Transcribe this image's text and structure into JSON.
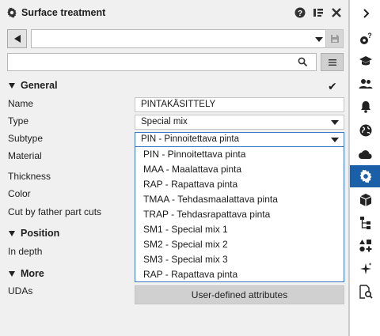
{
  "panel": {
    "title": "Surface treatment",
    "title_icon": "gear-icon",
    "header_icons": [
      "help-icon",
      "layout-icon",
      "close-icon"
    ]
  },
  "toolbar": {
    "preset_value": "",
    "search_placeholder": "",
    "search_value": ""
  },
  "sections": {
    "general": "General",
    "position": "Position",
    "more": "More"
  },
  "labels": {
    "name": "Name",
    "type": "Type",
    "subtype": "Subtype",
    "material": "Material",
    "thickness": "Thickness",
    "color": "Color",
    "cut_by_father": "Cut by father part cuts",
    "in_depth": "In depth",
    "udas": "UDAs"
  },
  "values": {
    "name": "PINTAKÄSITTELY",
    "type": "Special mix",
    "subtype": "PIN - Pinnoitettava pinta"
  },
  "subtype_options": [
    "PIN - Pinnoitettava pinta",
    "MAA - Maalattava pinta",
    "RAP - Rapattava pinta",
    "TMAA - Tehdasmaalattava pinta",
    "TRAP - Tehdasrapattava pinta",
    "SM1 - Special mix 1",
    "SM2 - Special mix 2",
    "SM3 - Special mix 3",
    "RAP - Rapattava pinta"
  ],
  "buttons": {
    "uda": "User-defined attributes"
  },
  "sidebar_icons": [
    "collapse-chevron-icon",
    "settings-help-icon",
    "graduation-cap-icon",
    "users-icon",
    "bell-icon",
    "globe-icon",
    "cloud-icon",
    "gear-icon",
    "box-icon",
    "hierarchy-icon",
    "shapes-add-icon",
    "sparkle-icon",
    "report-search-icon"
  ],
  "colors": {
    "accent": "#1a5fa8",
    "panel_bg": "#f0f0f0",
    "dropdown_border": "#3b78c4"
  }
}
